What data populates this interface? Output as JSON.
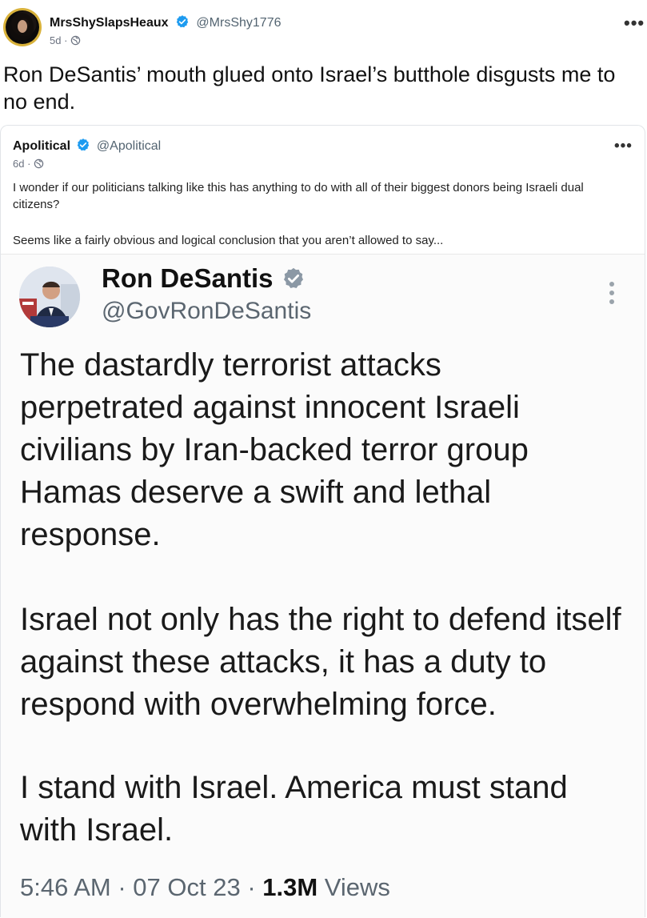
{
  "post": {
    "author_name": "MrsShySlapsHeaux",
    "author_handle": "@MrsShy1776",
    "age": "5d",
    "separator": "·",
    "more": "•••",
    "text": "Ron DeSantis’ mouth glued onto Israel’s butthole disgusts me to no end."
  },
  "quote": {
    "author_name": "Apolitical",
    "author_handle": "@Apolitical",
    "age": "6d",
    "separator": "·",
    "more": "•••",
    "text_p1": "I wonder if our politicians talking like this has anything to do with all of their biggest donors being Israeli dual citizens?",
    "text_p2": "Seems like a fairly obvious and logical conclusion that you aren’t allowed to say..."
  },
  "embedded_tweet": {
    "author_name": "Ron DeSantis",
    "author_handle": "@GovRonDeSantis",
    "paragraph1": "The dastardly terrorist attacks perpetrated against innocent Israeli civilians by Iran-backed terror group Hamas deserve a swift and lethal response.",
    "paragraph2": "Israel not only has the right to defend itself against these attacks, it has a duty to respond with overwhelming force.",
    "paragraph3": "I stand with Israel. America must stand with Israel.",
    "time": "5:46 AM · 07 Oct 23 · ",
    "views_count": "1.3M",
    "views_label": " Views"
  },
  "colors": {
    "verified_blue": "#1d9bf0",
    "embed_verified_gray": "#8b98a5",
    "text": "#0f1419",
    "muted": "#536471"
  },
  "icons": [
    "verified-badge-icon",
    "globe-icon",
    "more-dots-icon",
    "kebab-icon"
  ]
}
